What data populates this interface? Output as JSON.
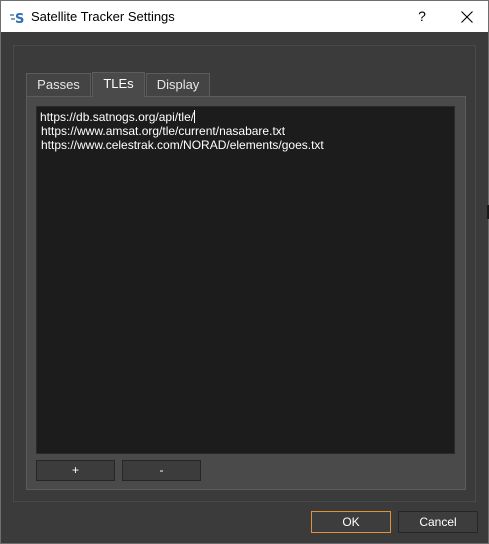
{
  "window": {
    "title": "Satellite Tracker Settings",
    "help_label": "?",
    "icon": "satellite-app-icon",
    "accent_color": "#e0913c"
  },
  "tabs": [
    {
      "label": "Passes",
      "active": false
    },
    {
      "label": "TLEs",
      "active": true
    },
    {
      "label": "Display",
      "active": false
    }
  ],
  "tle": {
    "urls": [
      "https://db.satnogs.org/api/tle/",
      "https://www.amsat.org/tle/current/nasabare.txt",
      "https://www.celestrak.com/NORAD/elements/goes.txt"
    ],
    "add_label": "+",
    "remove_label": "-"
  },
  "buttons": {
    "ok_label": "OK",
    "cancel_label": "Cancel"
  }
}
